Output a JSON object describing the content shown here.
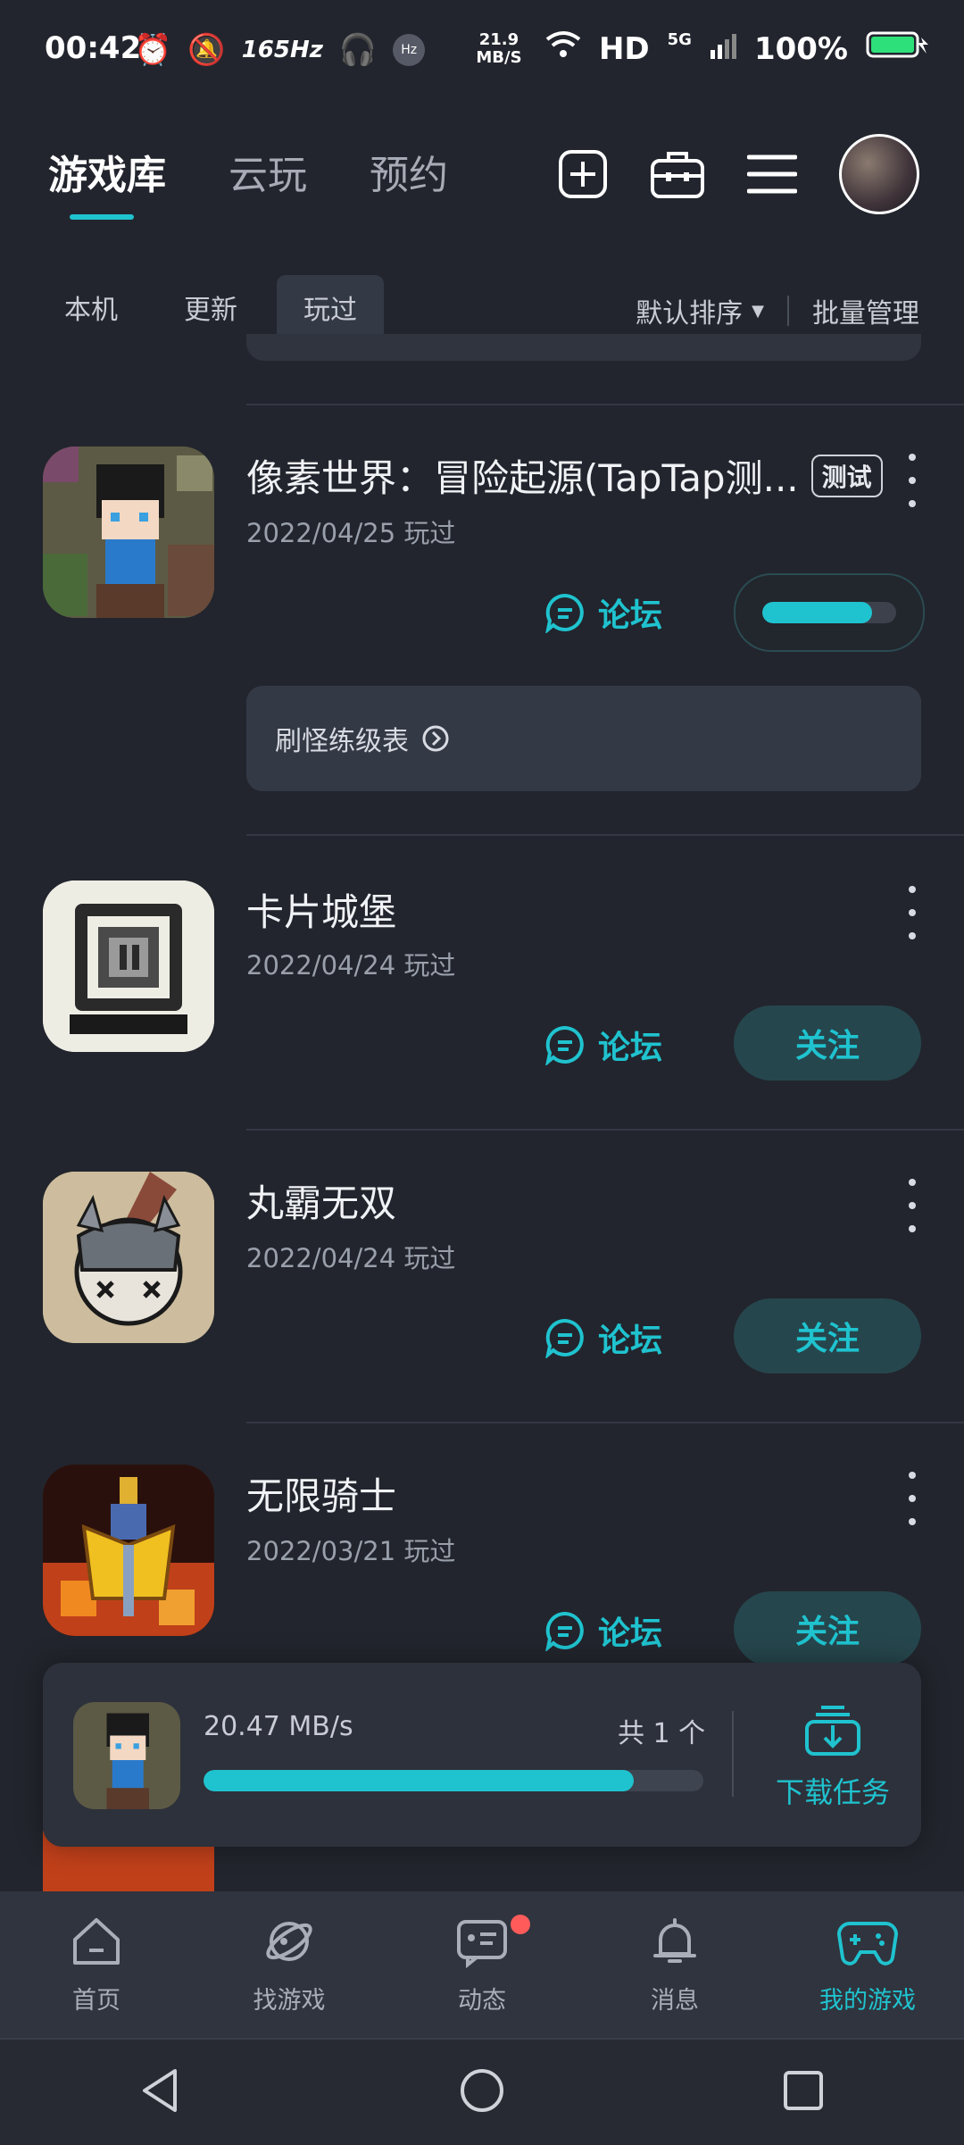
{
  "status_bar": {
    "time": "00:42",
    "refresh_rate": "165Hz",
    "net_speed": "21.9 MB/S",
    "hd": "HD",
    "network": "5G",
    "battery": "100%"
  },
  "top_tabs": [
    "游戏库",
    "云玩",
    "预约"
  ],
  "sub_tabs": [
    "本机",
    "更新",
    "玩过"
  ],
  "sort_label": "默认排序",
  "batch_label": "批量管理",
  "games": [
    {
      "title": "像素世界：冒险起源(TapTap测...",
      "badge": "测试",
      "date": "2022/04/25 玩过",
      "forum": "论坛",
      "progress": 0.82,
      "extra_card": "刷怪练级表"
    },
    {
      "title": "卡片城堡",
      "date": "2022/04/24 玩过",
      "forum": "论坛",
      "action": "关注"
    },
    {
      "title": "丸霸无双",
      "date": "2022/04/24 玩过",
      "forum": "论坛",
      "action": "关注"
    },
    {
      "title": "无限骑士",
      "date": "2022/03/21 玩过",
      "forum": "论坛",
      "action": "关注"
    }
  ],
  "download": {
    "speed": "20.47 MB/s",
    "count": "共 1 个",
    "progress": 0.86,
    "task_label": "下载任务"
  },
  "bottom_nav": [
    "首页",
    "找游戏",
    "动态",
    "消息",
    "我的游戏"
  ],
  "colors": {
    "accent": "#1fc3cf",
    "background": "#22252d"
  },
  "icons": [
    "alarm-icon",
    "mute-icon",
    "headphones-icon",
    "wifi-icon",
    "signal-icon",
    "battery-icon",
    "add-icon",
    "toolbox-icon",
    "menu-icon",
    "forum-icon",
    "chevron-right-circle-icon",
    "download-icon",
    "home-icon",
    "discover-icon",
    "feed-icon",
    "bell-icon",
    "gamepad-icon",
    "back-icon",
    "home-circle-icon",
    "recents-icon"
  ]
}
